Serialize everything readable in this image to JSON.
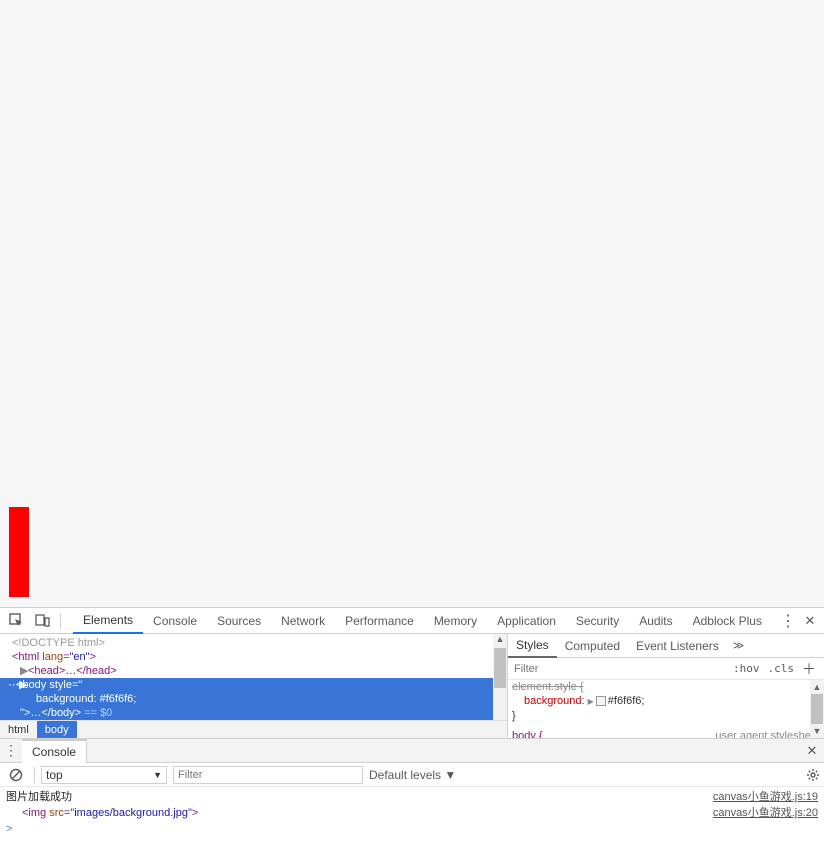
{
  "page": {
    "bg": "#f6f6f6"
  },
  "tabs": {
    "items": [
      "Elements",
      "Console",
      "Sources",
      "Network",
      "Performance",
      "Memory",
      "Application",
      "Security",
      "Audits",
      "Adblock Plus"
    ],
    "active": 0
  },
  "dom": {
    "l1": "<!DOCTYPE html>",
    "l2_open": "<html ",
    "l2_attr": "lang",
    "l2_val": "\"en\"",
    "l2_close": ">",
    "l3_open": "<head>",
    "l3_ell": "…",
    "l3_close": "</head>",
    "l4_open": "<body ",
    "l4_attr": "style",
    "l4_eq": "=\"",
    "l4_prop": "background: #f6f6f6;",
    "l4_end": "…",
    "l4_close": "</body>",
    "l4_eq0": " == $0",
    "bc": [
      "html",
      "body"
    ]
  },
  "styles": {
    "tabs": [
      "Styles",
      "Computed",
      "Event Listeners"
    ],
    "filter_ph": "Filter",
    "hov": ":hov",
    "cls": ".cls",
    "rule_sel": "element.style {",
    "prop_name": "background",
    "prop_val": "#f6f6f6",
    "close": "}",
    "ua_sel": "body {",
    "ua_src": "user agent stylesheet"
  },
  "drawer": {
    "tab": "Console",
    "context": "top",
    "filter_ph": "Filter",
    "levels": "Default levels",
    "msg1": "图片加载成功",
    "msg1_loc": "canvas小鱼游戏.js:19",
    "msg2_pre": "<img ",
    "msg2_attr": "src",
    "msg2_val": "\"images/background.jpg\"",
    "msg2_post": ">",
    "msg2_loc": "canvas小鱼游戏.js:20",
    "prompt": ">"
  }
}
